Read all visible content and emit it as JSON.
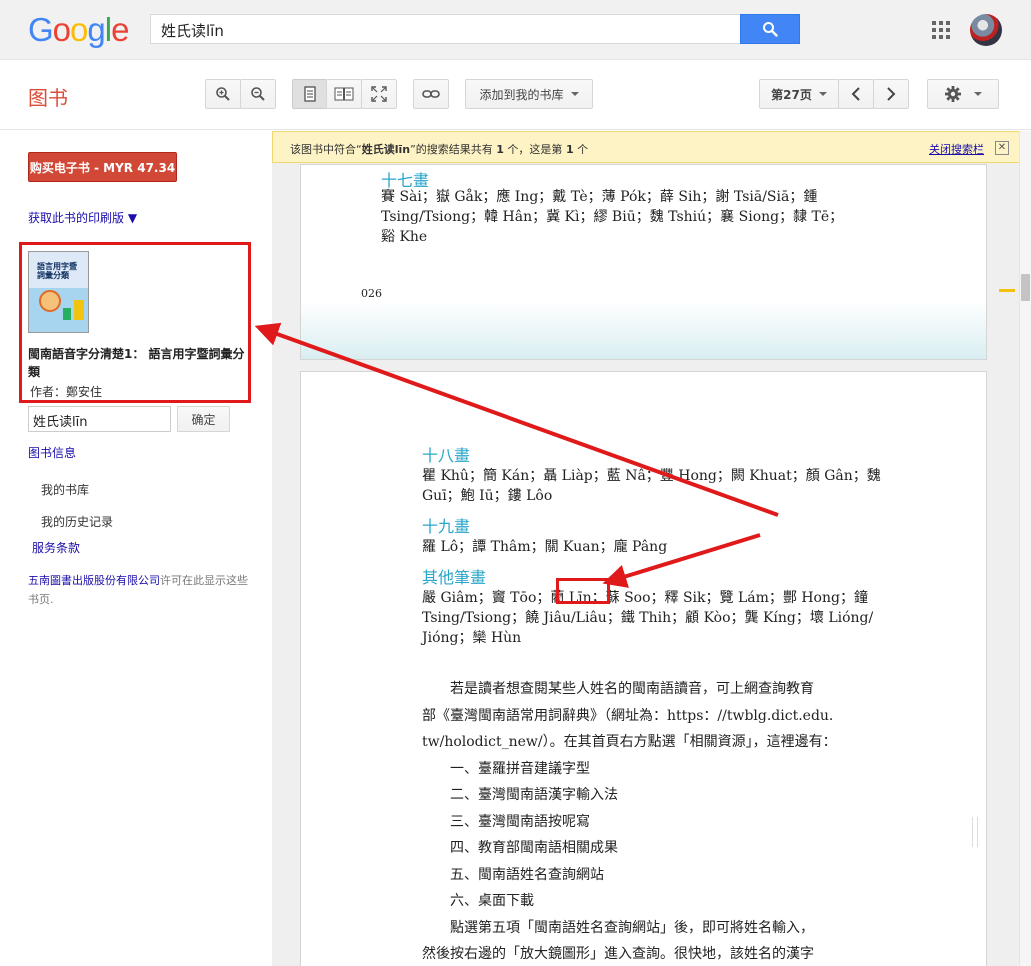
{
  "google": {
    "logo_letters": [
      {
        "ch": "G",
        "color": "#4285F4"
      },
      {
        "ch": "o",
        "color": "#EA4335"
      },
      {
        "ch": "o",
        "color": "#FBBC05"
      },
      {
        "ch": "g",
        "color": "#4285F4"
      },
      {
        "ch": "l",
        "color": "#34A853"
      },
      {
        "ch": "e",
        "color": "#EA4335"
      }
    ],
    "search_query": "姓氏读līn"
  },
  "toolbar": {
    "brand": "图书",
    "add_to_library": "添加到我的书库",
    "page_indicator": "第27页"
  },
  "sidebar": {
    "buy_ebook": "购买电子书 - MYR 47.34",
    "get_print": "获取此书的印刷版 ▼",
    "book": {
      "cover_text": "語言用字暨詞彙分類",
      "title": "閩南語音字分清楚1： 語言用字暨詞彙分類",
      "author": "作者：鄭安住"
    },
    "in_book_search": "姓氏读līn",
    "confirm": "确定",
    "book_info": "图书信息",
    "my_library": "我的书库",
    "my_history": "我的历史记录",
    "terms": "服务条款",
    "publisher": "五南圖書出版股份有限公司",
    "permission_rest": "许可在此显示这些书页."
  },
  "reader": {
    "banner_prefix": "该图书中符合“",
    "banner_query": "姓氏读līn",
    "banner_mid": "”的搜索结果共有 ",
    "banner_count": "1",
    "banner_mid2": " 个，这是第 ",
    "banner_index": "1",
    "banner_suffix": " 个",
    "close_search": "关闭搜索栏",
    "page1": {
      "heading": "十七畫",
      "lines": [
        "賽 Sài；嶽 Gåk；應 Ing；戴 Tè；薄 Pók；薛 Sih；謝 Tsiā/Siā；鍾",
        "Tsing/Tsiong；韓 Hân；冀 Kì；繆 Biū；魏 Tshiú；襄 Siong；隸 Tē；",
        "谿 Khe"
      ],
      "page_number": "026"
    },
    "page2": {
      "sections": [
        {
          "heading": "十八畫",
          "lines": [
            "瞿 Khû；簡 Kán；聶 Liàp；藍 Nâ；豐 Hong；闕 Khuat；顏 Gân；魏",
            "Guī；鮑 Iū；鏤 Lôo"
          ]
        },
        {
          "heading": "十九畫",
          "lines": [
            "羅 Lô；譚 Thâm；關 Kuan；龐 Pâng"
          ]
        },
        {
          "heading": "其他筆畫",
          "lines": [
            "嚴 Giâm；竇 Tōo；藺 Līn；蘇 Soo；釋 Sik；覽 Lám；酆 Hong；鐘",
            "Tsing/Tsiong；饒 Jiâu/Liâu；鐵 Thih；顧 Kòo；龔 Kíng；壞 Lióng/",
            "Jióng；欒 Hùn"
          ]
        }
      ],
      "paragraph_lines": [
        "　　若是讀者想查閱某些人姓名的閩南語讀音，可上網查詢教育",
        "部《臺灣閩南語常用詞辭典》（網址為：https：//twblg.dict.edu.",
        "tw/holodict_new/）。在其首頁右方點選「相關資源」，這裡邊有：",
        "　　一、臺羅拼音建議字型",
        "　　二、臺灣閩南語漢字輸入法",
        "　　三、臺灣閩南語按呢寫",
        "　　四、教育部閩南語相關成果",
        "　　五、閩南語姓名查詢網站",
        "　　六、桌面下載",
        "　　點選第五項「閩南語姓名查詢網站」後，即可將姓名輸入，",
        "然後按右邊的「放大鏡圖形」進入查詢。很快地，該姓名的漢字"
      ]
    }
  },
  "colors": {
    "annotation_red": "#e01a1a",
    "heading_teal": "#2aa6c8",
    "buy_red": "#d14836",
    "search_blue": "#4285f4"
  }
}
